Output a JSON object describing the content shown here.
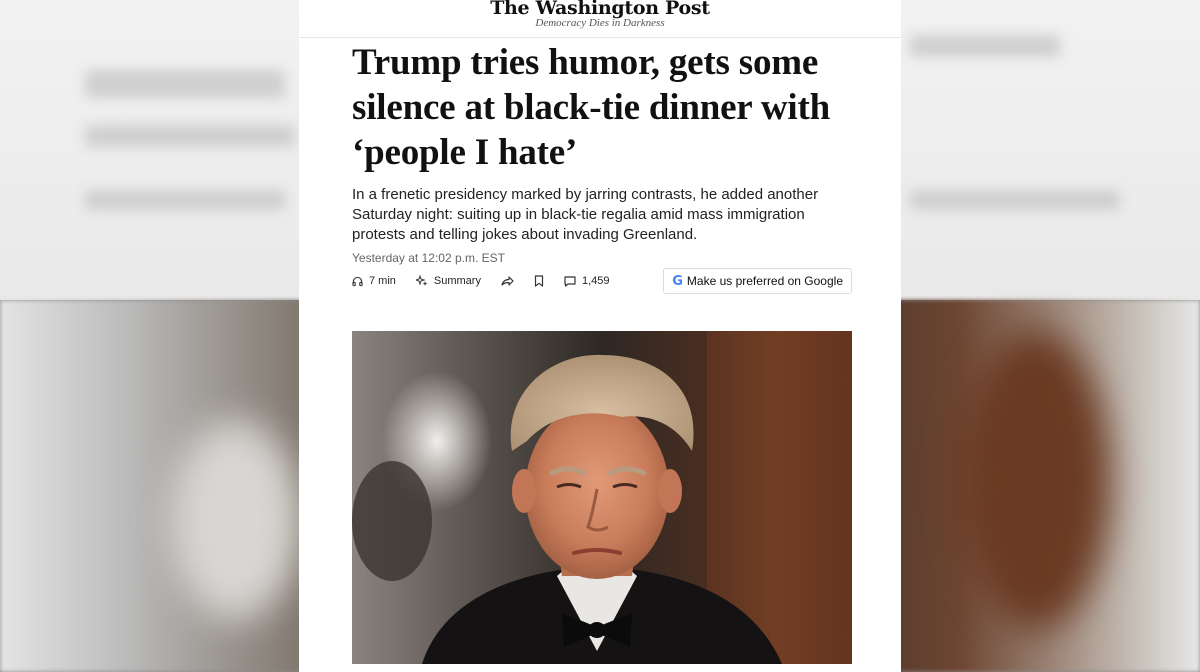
{
  "masthead": {
    "logo": "The Washington Post",
    "tagline": "Democracy Dies in Darkness"
  },
  "article": {
    "headline": "Trump tries humor, gets some silence at black-tie dinner with ‘people I hate’",
    "dek": "In a frenetic presidency marked by jarring contrasts, he added another Saturday night: suiting up in black-tie regalia amid mass immigration protests and telling jokes about invading Greenland.",
    "timestamp": "Yesterday at 12:02 p.m. EST"
  },
  "toolbar": {
    "listen_label": "7 min",
    "summary_label": "Summary",
    "comments_count": "1,459",
    "google_label": "Make us preferred on Google",
    "google_letter": "G"
  },
  "icons": {
    "listen": "headphones-icon",
    "summary": "sparkle-icon",
    "share": "share-icon",
    "save": "bookmark-icon",
    "comments": "comment-icon"
  },
  "colors": {
    "text": "#111111",
    "muted": "#666666",
    "google_blue": "#4285f4"
  }
}
